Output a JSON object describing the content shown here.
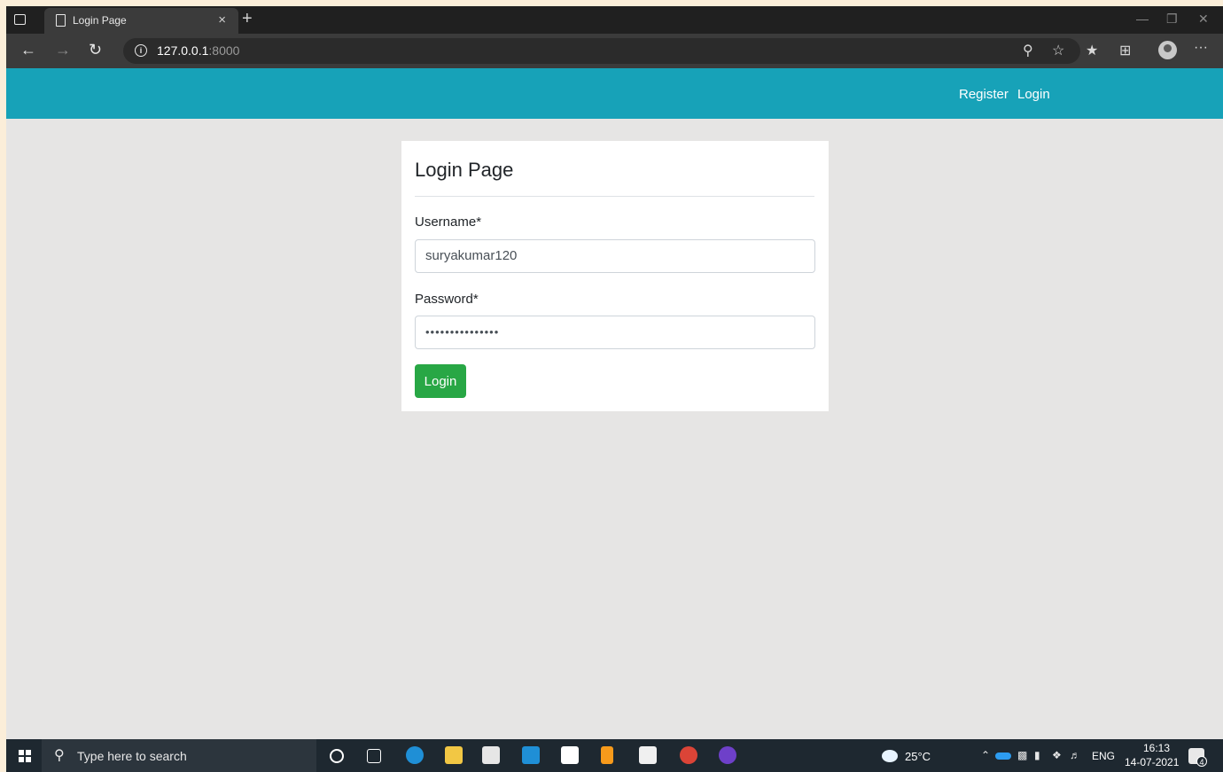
{
  "browser": {
    "tab_title": "Login Page",
    "tab_close": "×",
    "new_tab": "+",
    "url_host": "127.0.0.1",
    "url_port": ":8000",
    "more_label": "···"
  },
  "navbar": {
    "links": [
      "Register",
      "Login"
    ],
    "color": "#17a2b8"
  },
  "login_card": {
    "title": "Login Page",
    "username_label": "Username*",
    "username_value": "suryakumar120",
    "password_label": "Password*",
    "password_value": "•••••••••••••••",
    "submit_label": "Login",
    "submit_color": "#28a745"
  },
  "taskbar": {
    "search_placeholder": "Type here to search",
    "weather": "25°C",
    "language": "ENG",
    "time": "16:13",
    "date": "14-07-2021",
    "notification_count": "4",
    "apps": [
      "cortana-icon",
      "task-view-icon",
      "edge-icon",
      "file-explorer-icon",
      "store-icon",
      "mail-icon",
      "gift-app-icon",
      "sublime-icon",
      "terminal-icon",
      "chrome-icon",
      "github-desktop-icon"
    ]
  }
}
